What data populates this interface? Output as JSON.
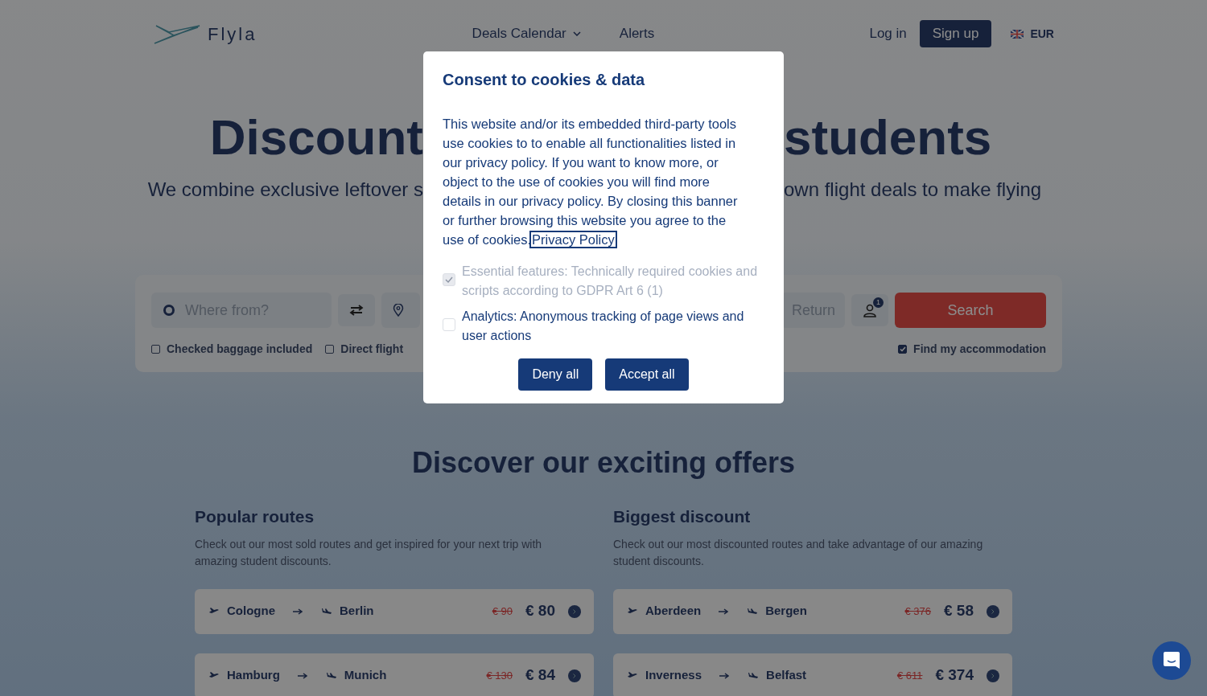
{
  "header": {
    "logo": "Flyla",
    "nav": [
      {
        "label": "Deals Calendar",
        "dropdown": true
      },
      {
        "label": "Alerts",
        "dropdown": false
      }
    ],
    "login": "Log in",
    "signup": "Sign up",
    "currency": "EUR"
  },
  "hero": {
    "title_left": "Discount",
    "title_right": "students",
    "subtitle_left": "We combine exclusive leftover s",
    "subtitle_right": "own flight deals to make flying"
  },
  "search": {
    "from_placeholder": "Where from?",
    "return_placeholder": "Return",
    "passengers": "1",
    "button": "Search",
    "options_left": [
      {
        "label": "Checked baggage included",
        "checked": false
      },
      {
        "label": "Direct flight",
        "checked": false
      }
    ],
    "options_right": [
      {
        "label": "Find my accommodation",
        "checked": true
      }
    ]
  },
  "offers": {
    "title": "Discover our exciting offers",
    "columns": [
      {
        "title": "Popular routes",
        "description": "Check out our most sold routes and get inspired for your next trip with amazing student discounts.",
        "routes": [
          {
            "from": "Cologne",
            "to": "Berlin",
            "old_price": "€ 90",
            "price": "€ 80"
          },
          {
            "from": "Hamburg",
            "to": "Munich",
            "old_price": "€ 130",
            "price": "€ 84"
          }
        ]
      },
      {
        "title": "Biggest discount",
        "description": "Check out our most discounted routes and take advantage of our amazing student discounts.",
        "routes": [
          {
            "from": "Aberdeen",
            "to": "Bergen",
            "old_price": "€ 376",
            "price": "€ 58"
          },
          {
            "from": "Inverness",
            "to": "Belfast",
            "old_price": "€ 611",
            "price": "€ 374"
          }
        ]
      }
    ]
  },
  "cookie_dialog": {
    "title": "Consent to cookies & data",
    "text": "This website and/or its embedded third-party tools use cookies to to enable all functionalities listed in our privacy policy. If you want to know more, or object to the use of cookies you will find more details in our privacy policy. By closing this banner or further browsing this website you agree to the use of cookies.",
    "link": "Privacy Policy",
    "options": [
      {
        "label": "Essential features: Technically required cookies and scripts according to GDPR Art 6 (1)",
        "checked": true,
        "disabled": true
      },
      {
        "label": "Analytics: Anonymous tracking of page views and user actions",
        "checked": false,
        "disabled": false
      }
    ],
    "buttons": [
      "Deny all",
      "Accept all"
    ]
  }
}
